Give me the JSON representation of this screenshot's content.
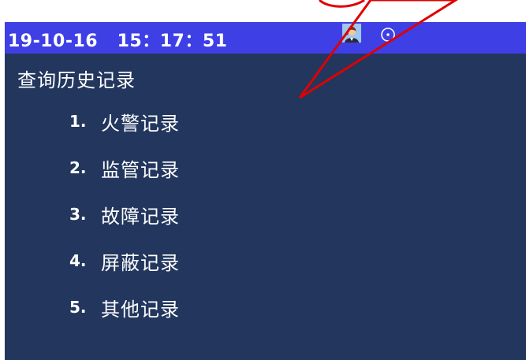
{
  "status_bar": {
    "datetime": "19-10-16   15：17：51",
    "user_icon": "user-avatar-icon",
    "status_icon": "circle-dot-icon"
  },
  "page": {
    "title": "查询历史记录"
  },
  "menu": {
    "items": [
      {
        "number": "1.",
        "label": "火警记录"
      },
      {
        "number": "2.",
        "label": "监管记录"
      },
      {
        "number": "3.",
        "label": "故障记录"
      },
      {
        "number": "4.",
        "label": "屏蔽记录"
      },
      {
        "number": "5.",
        "label": "其他记录"
      }
    ]
  },
  "colors": {
    "screen_background": "#22365e",
    "status_bar_background": "#3f3fe6",
    "text": "#ffffff",
    "annotation": "#e00000"
  }
}
